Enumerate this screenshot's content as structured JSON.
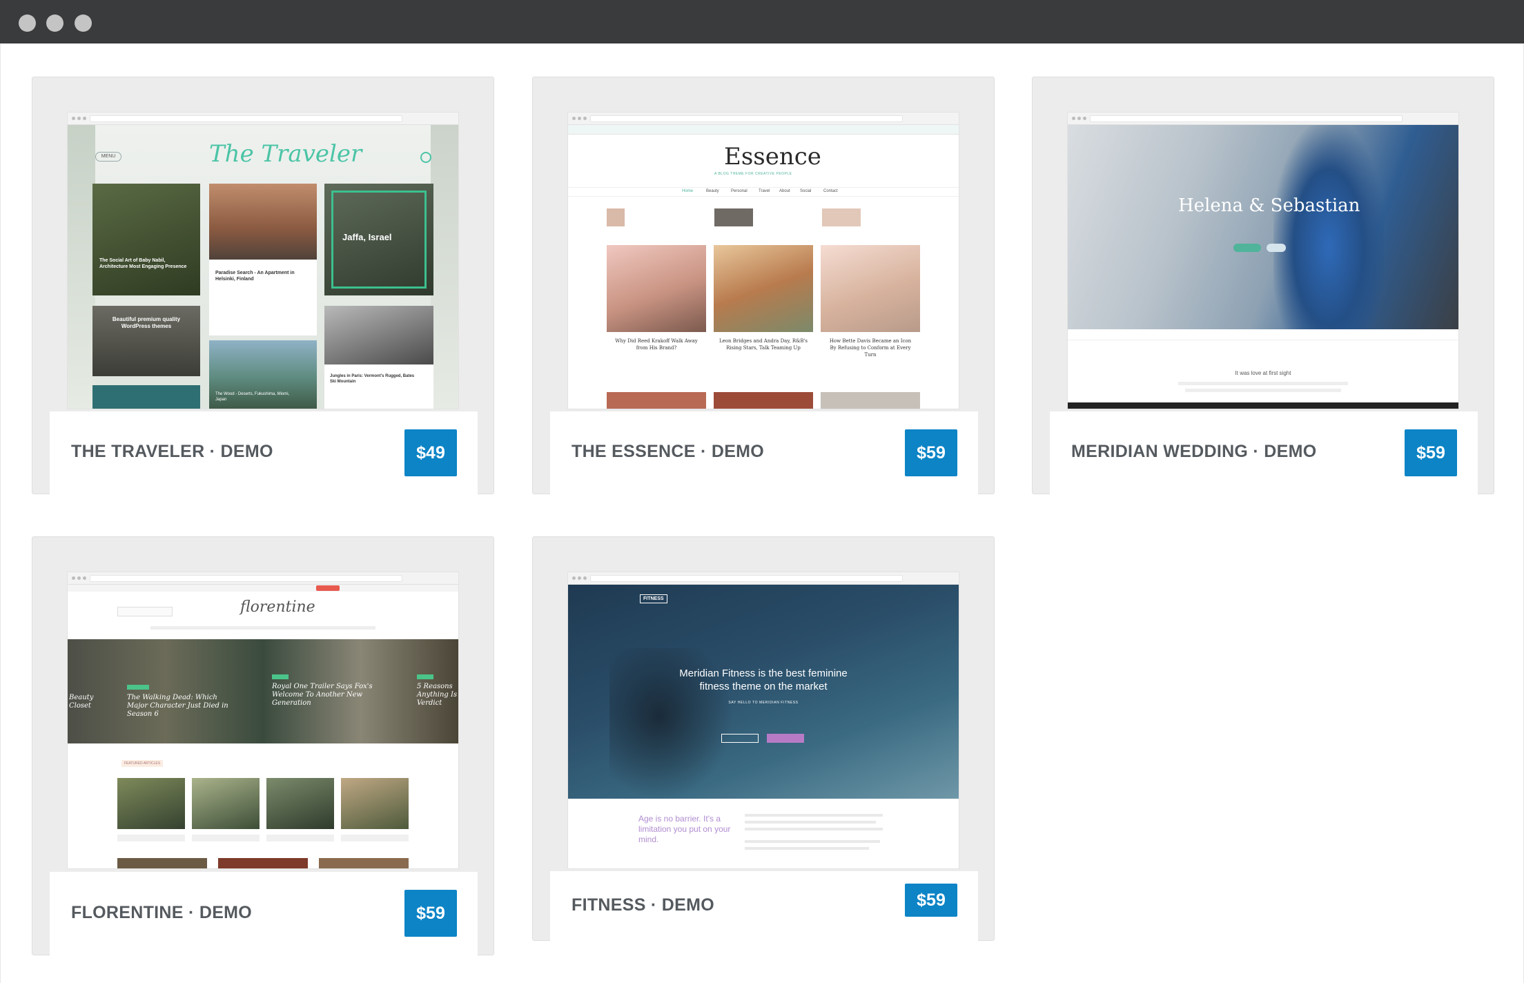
{
  "window": {
    "controls": [
      "close-dot",
      "minimize-dot",
      "maximize-dot"
    ]
  },
  "cards": [
    {
      "title": "THE TRAVELER · DEMO",
      "price": "$49",
      "preview": {
        "logo": "The Traveler",
        "menu_label": "MENU",
        "feature_title": "Jaffa, Israel",
        "promo_text": "Beautiful premium quality WordPress themes",
        "post_1": "The Social Art of Baby Nabil, Architecture Most Engaging Presence",
        "post_2": "Paradise Search - An Apartment in Helsinki, Finland",
        "post_3": "The Wood - Deserts, Fukushima, Miomi, Japan",
        "post_4": "Jungles in Paris: Vermont's Rugged, Bates Ski Mountain"
      }
    },
    {
      "title": "THE ESSENCE · DEMO",
      "price": "$59",
      "preview": {
        "logo": "Essence",
        "tagline": "A BLOG THEME FOR CREATIVE PEOPLE",
        "nav": [
          "Home",
          "Beauty",
          "Personal",
          "Travel",
          "About",
          "Social",
          "Contact"
        ],
        "post_1": "Why Did Reed Krakoff Walk Away from His Brand?",
        "post_2": "Leon Bridges and Andra Day, R&B's Rising Stars, Talk Teaming Up",
        "post_3": "How Bette Davis Became an Icon By Refusing to Conform at Every Turn"
      }
    },
    {
      "title": "MERIDIAN WEDDING · DEMO",
      "price": "$59",
      "preview": {
        "hero_title": "Helena & Sebastian",
        "section_title": "It was love at first sight"
      }
    },
    {
      "title": "FLORENTINE · DEMO",
      "price": "$59",
      "preview": {
        "logo": "florentine",
        "slide_1": "Beauty Closet",
        "slide_2": "The Walking Dead: Which Major Character Just Died in Season 6",
        "slide_3": "Royal One Trailer Says Fox's Welcome To Another New Generation",
        "slide_4": "5 Reasons Anything Is Verdict",
        "section_label": "FEATURED ARTICLES"
      }
    },
    {
      "title": "FITNESS · DEMO",
      "price": "$59",
      "preview": {
        "logo": "FITNESS",
        "hero_line_1": "Meridian Fitness is the best feminine",
        "hero_line_2": "fitness theme on the market",
        "hero_sub": "SAY HELLO TO MERIDIAN FITNESS",
        "quote": "Age is no barrier. It's a limitation you put on your mind."
      }
    }
  ]
}
